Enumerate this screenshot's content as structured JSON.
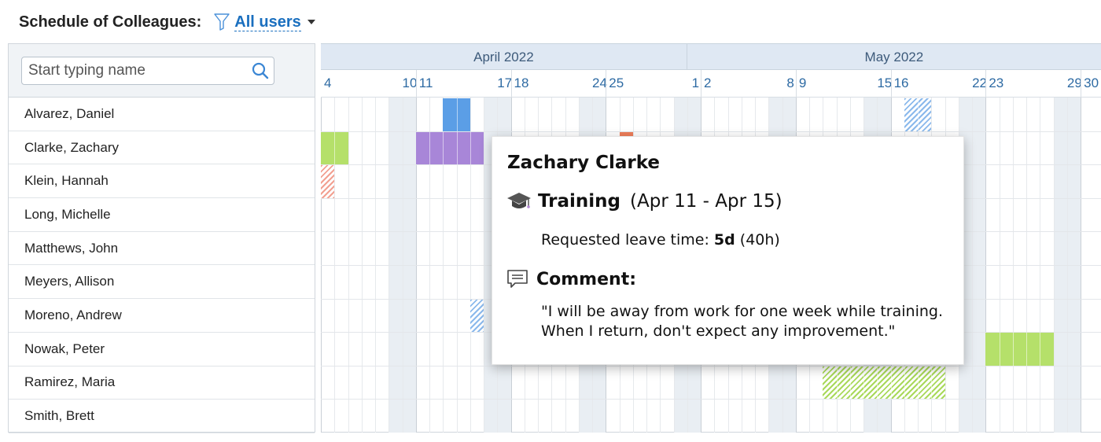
{
  "header": {
    "title": "Schedule of Colleagues:",
    "filter_label": "All users",
    "filter_icon": "filter-icon"
  },
  "search": {
    "placeholder": "Start typing name",
    "icon": "search-icon"
  },
  "colleagues": [
    "Alvarez, Daniel",
    "Clarke, Zachary",
    "Klein, Hannah",
    "Long, Michelle",
    "Matthews, John",
    "Meyers, Allison",
    "Moreno, Andrew",
    "Nowak, Peter",
    "Ramirez, Maria",
    "Smith, Brett"
  ],
  "calendar": {
    "months": [
      "April 2022",
      "May 2022"
    ],
    "start_date": "2022-04-04",
    "day_count": 57,
    "visible_day_labels": {
      "april": [
        "4",
        "10",
        "11",
        "17",
        "18",
        "24",
        "25"
      ],
      "may": [
        "1",
        "2",
        "8",
        "9",
        "15",
        "16",
        "22",
        "23",
        "29",
        "30"
      ]
    }
  },
  "absences": [
    {
      "person": "Alvarez, Daniel",
      "type": "blue",
      "start": "2022-04-13",
      "end": "2022-04-14",
      "status": "approved"
    },
    {
      "person": "Alvarez, Daniel",
      "type": "hatch-blue",
      "start": "2022-05-17",
      "end": "2022-05-18",
      "status": "pending"
    },
    {
      "person": "Clarke, Zachary",
      "type": "green",
      "start": "2022-04-04",
      "end": "2022-04-05",
      "status": "approved"
    },
    {
      "person": "Clarke, Zachary",
      "type": "purple",
      "start": "2022-04-11",
      "end": "2022-04-15",
      "status": "approved"
    },
    {
      "person": "Clarke, Zachary",
      "type": "orange",
      "start": "2022-04-26",
      "end": "2022-04-26",
      "status": "approved"
    },
    {
      "person": "Klein, Hannah",
      "type": "hatch-red",
      "start": "2022-04-04",
      "end": "2022-04-04",
      "status": "pending"
    },
    {
      "person": "Moreno, Andrew",
      "type": "hatch-blue",
      "start": "2022-04-15",
      "end": "2022-04-15",
      "status": "pending"
    },
    {
      "person": "Nowak, Peter",
      "type": "green",
      "start": "2022-05-23",
      "end": "2022-05-27",
      "status": "approved"
    },
    {
      "person": "Ramirez, Maria",
      "type": "hatch-green",
      "start": "2022-05-11",
      "end": "2022-05-19",
      "status": "pending"
    }
  ],
  "tooltip": {
    "name": "Zachary Clarke",
    "type_icon": "graduation-cap-icon",
    "type": "Training",
    "range": "(Apr 11 - Apr 15)",
    "requested_label": "Requested leave time: ",
    "requested_days": "5d",
    "requested_hours": " (40h)",
    "comment_icon": "comment-icon",
    "comment_label": "Comment:",
    "comment_line1": "\"I will be away from work for one week while training.",
    "comment_line2": "When I return, don't expect any improvement.\""
  },
  "colors": {
    "accent": "#1a6fbf",
    "training": "#a886d8",
    "vacation": "#b5e06a",
    "sick": "#5b9ee6",
    "other": "#ef7e5a"
  }
}
